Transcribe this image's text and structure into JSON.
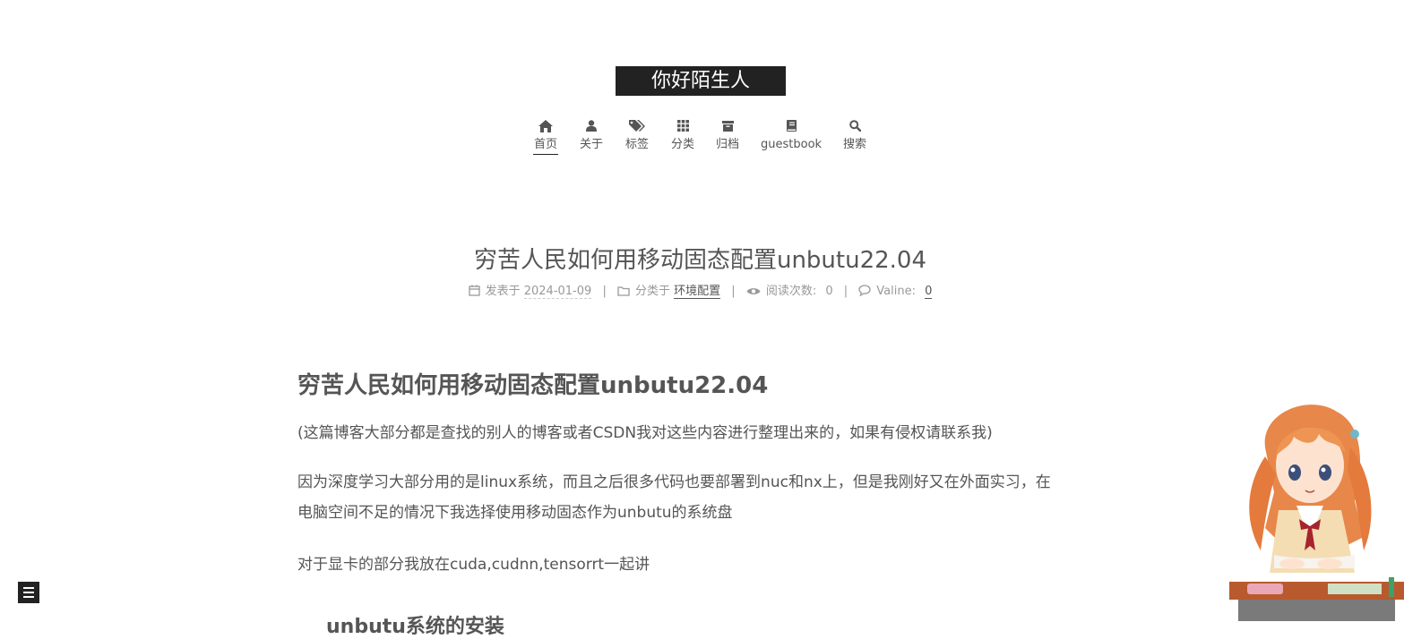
{
  "site": {
    "title": "你好陌生人"
  },
  "nav": {
    "items": [
      {
        "label": "首页",
        "icon": "home-icon",
        "active": true
      },
      {
        "label": "关于",
        "icon": "user-icon"
      },
      {
        "label": "标签",
        "icon": "tags-icon"
      },
      {
        "label": "分类",
        "icon": "th-icon"
      },
      {
        "label": "归档",
        "icon": "archive-icon"
      },
      {
        "label": "guestbook",
        "icon": "book-icon"
      },
      {
        "label": "搜索",
        "icon": "search-icon"
      }
    ]
  },
  "post": {
    "title": "穷苦人民如何用移动固态配置unbutu22.04",
    "meta": {
      "posted_label": "发表于",
      "posted_date": "2024-01-09",
      "category_label": "分类于",
      "category": "环境配置",
      "views_label": "阅读次数:",
      "views": "0",
      "comments_label": "Valine:",
      "comments": "0"
    }
  },
  "content": {
    "heading": "穷苦人民如何用移动固态配置unbutu22.04",
    "p1": "(这篇博客大部分都是查找的别人的博客或者CSDN我对这些内容进行整理出来的，如果有侵权请联系我)",
    "p2_line1": "因为深度学习大部分用的是linux系统，而且之后很多代码也要部署到nuc和nx上，但是我刚好又在外面实习，在",
    "p2_line2": "电脑空间不足的情况下我选择使用移动固态作为unbutu的系统盘",
    "p3": "对于显卡的部分我放在cuda,cudnn,tensorrt一起讲",
    "h2": "unbutu系统的安装"
  },
  "colors": {
    "title_bg": "#222222",
    "text": "#555555",
    "meta": "#999999"
  }
}
